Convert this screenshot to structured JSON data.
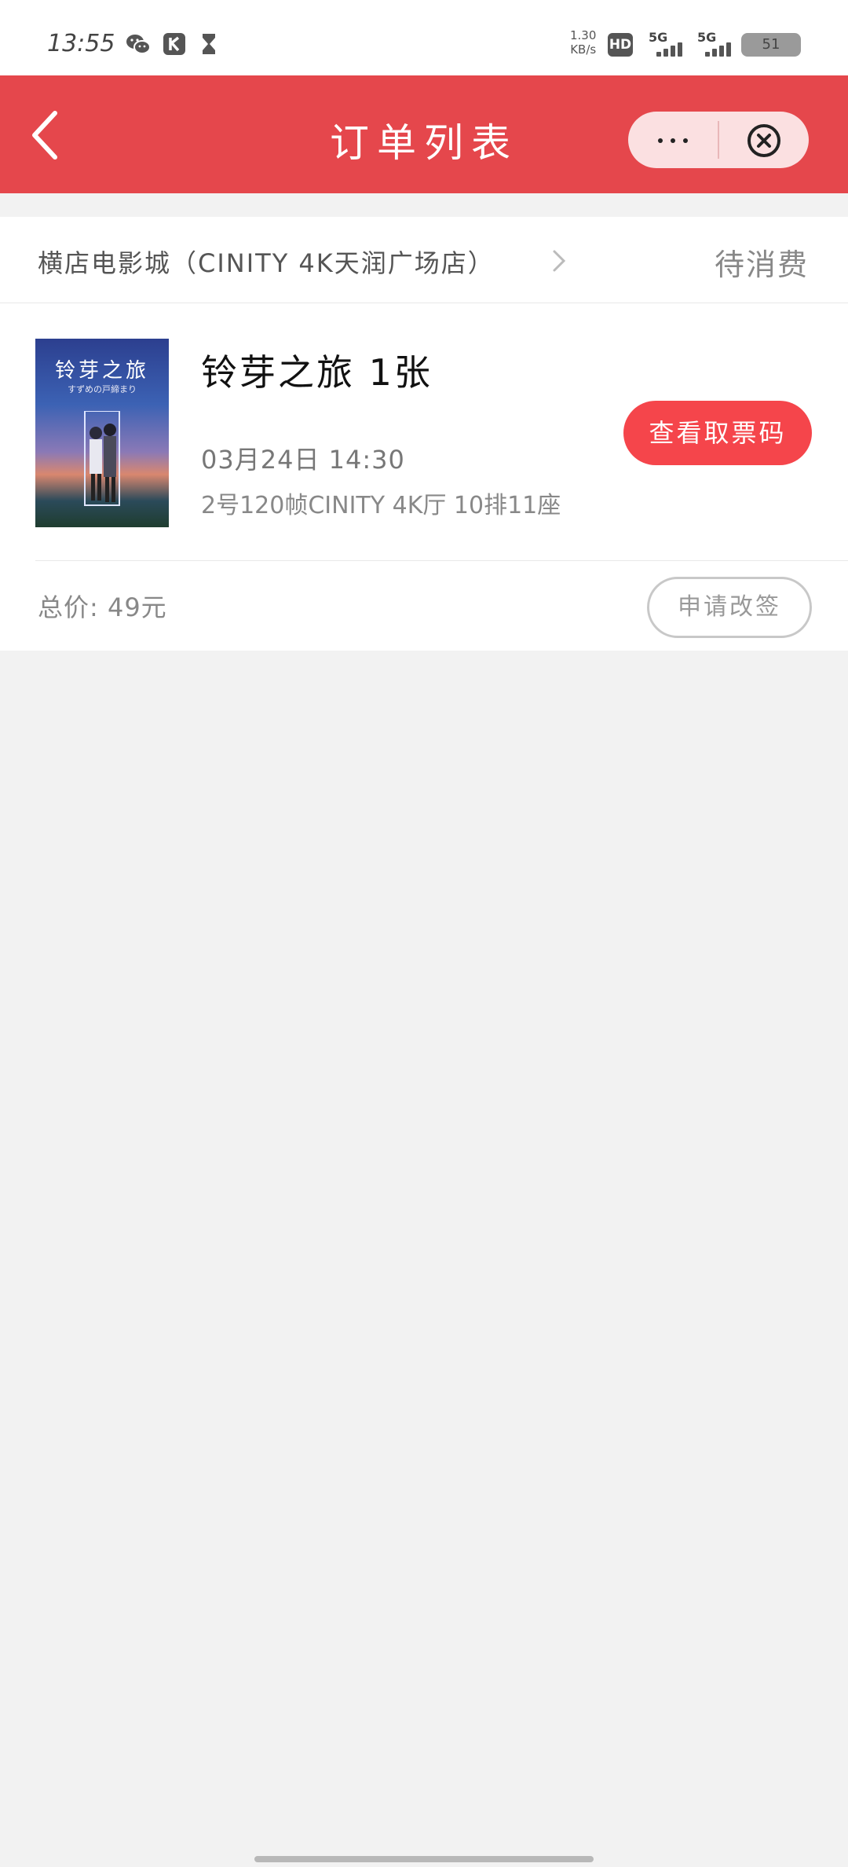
{
  "status_bar": {
    "time": "13:55",
    "net_speed_value": "1.30",
    "net_speed_unit": "KB/s",
    "hd_label": "HD",
    "sim1_label": "5G",
    "sim2_label": "5G",
    "battery_label": "51",
    "icons": [
      "wechat-icon",
      "k-app-icon",
      "hourglass-icon"
    ]
  },
  "app_bar": {
    "title": "订单列表",
    "back_icon": "chevron-left-icon",
    "more_icon": "more-dots-icon",
    "close_icon": "close-circle-icon",
    "accent_color": "#e5474c"
  },
  "order": {
    "cinema_name": "横店电影城（CINITY 4K天润广场店）",
    "status": "待消费",
    "poster": {
      "title": "铃芽之旅",
      "subtitle": "すずめの戸締まり"
    },
    "movie_title": "铃芽之旅 1张",
    "show_time": "03月24日 14:30",
    "seat_info": "2号120帧CINITY 4K厅 10排11座",
    "ticket_code_label": "查看取票码",
    "total_price": "总价: 49元",
    "change_label": "申请改签",
    "button_color": "#f5454b"
  }
}
